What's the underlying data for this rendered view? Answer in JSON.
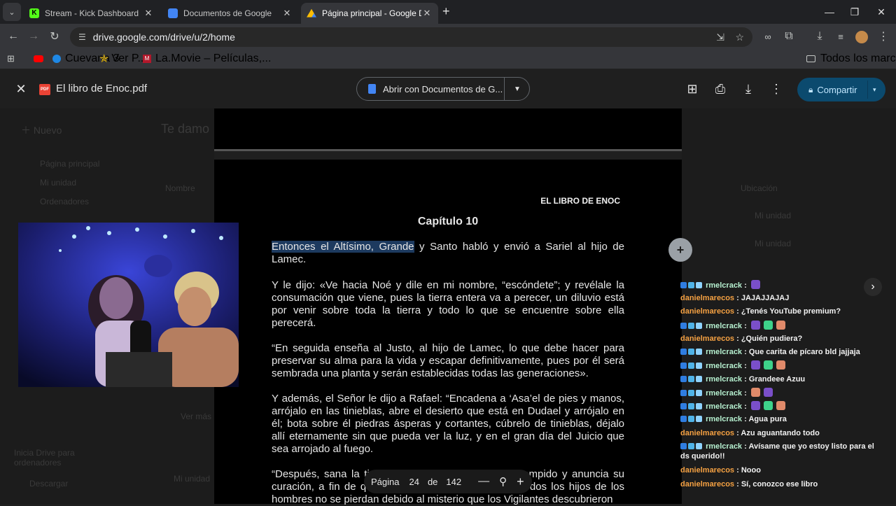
{
  "browser": {
    "tabs": [
      {
        "title": "Stream - Kick Dashboard",
        "favicon_color": "#53fc18"
      },
      {
        "title": "Documentos de Google",
        "favicon_color": "#4285f4"
      },
      {
        "title": "Página principal - Google Drive",
        "favicon_color": "#fbbc04"
      }
    ],
    "new_tab": "+",
    "url": "drive.google.com/drive/u/2/home",
    "bookmarks": [
      {
        "label": "",
        "icon": "youtube-icon"
      },
      {
        "label": "Cuevana 3",
        "icon": "cuevana-icon"
      },
      {
        "label": "Ver P...",
        "icon": "star-icon"
      },
      {
        "label": "La.Movie – Películas,...",
        "icon": "lamovie-icon"
      }
    ],
    "all_bookmarks": "Todos los marcadores"
  },
  "viewer": {
    "file_name": "El libro de Enoc.pdf",
    "open_with": "Abrir con Documentos de G...",
    "share": "Compartir"
  },
  "background_drive": {
    "new_button": "Nuevo",
    "greeting": "Te damo",
    "nav": [
      "Página principal",
      "Mi unidad",
      "Ordenadores"
    ],
    "col_name": "Nombre",
    "col_location": "Ubicación",
    "locations": [
      "Mi unidad",
      "Mi unidad"
    ],
    "storage_text": "Inicia Drive para ordenadores",
    "download": "Descargar",
    "my_drive_bottom": "Mi unidad",
    "ver_mas": "Ver más"
  },
  "pdf": {
    "header": "EL LIBRO DE ENOC",
    "chapter": "Capítulo 10",
    "p1_highlight": "Entonces el Altísimo, Grande",
    "p1_rest": " y Santo habló y envió a Sariel al hijo de Lamec.",
    "p2": "Y le dijo: «Ve hacia Noé y dile en mi nombre, “escóndete”; y revélale la consumación que viene, pues la tierra entera va a perecer, un diluvio está por venir sobre toda la tierra y todo lo que se encuentre sobre ella perecerá.",
    "p3": "“En seguida enseña al Justo, al hijo de Lamec, lo que debe hacer para preservar su alma para la vida y escapar definitivamente, pues por él será sembrada una planta y serán establecidas todas las generaciones».",
    "p4": "Y además, el Señor le dijo a Rafael: “Encadena a ‘Asa’el de pies y manos, arrójalo en las tinieblas, abre el desierto que está en Dudael y arrójalo en él; bota sobre él piedras ásperas y cortantes, cúbrelo de tinieblas, déjalo allí eternamente sin que pueda ver la luz, y en el gran día del Juicio que sea arrojado al fuego.",
    "p5": "“Después, sana la tierra que los Vigilantes han corrompido y anuncia su curación, a fin de que se sanen de la plaga y que todos los hijos de los hombres no se pierdan debido al misterio que los Vigilantes descubrieron"
  },
  "page_nav": {
    "label": "Página",
    "current": "24",
    "of": "de",
    "total": "142"
  },
  "chat": {
    "messages": [
      {
        "user": "rmelcrack",
        "text": "",
        "emotes": 1,
        "badges": true,
        "color": "nm1"
      },
      {
        "user": "danielmarecos",
        "text": " JAJAJJAJAJ",
        "emotes": 0,
        "badges": false,
        "color": "nm2"
      },
      {
        "user": "danielmarecos",
        "text": " ¿Tenés YouTube premium?",
        "emotes": 0,
        "badges": false,
        "color": "nm2"
      },
      {
        "user": "rmelcrack",
        "text": "",
        "emotes": 3,
        "badges": true,
        "color": "nm1"
      },
      {
        "user": "danielmarecos",
        "text": " ¿Quién pudiera?",
        "emotes": 0,
        "badges": false,
        "color": "nm2"
      },
      {
        "user": "rmelcrack",
        "text": " Que carita de pícaro bld jajjaja",
        "emotes": 0,
        "badges": true,
        "color": "nm1"
      },
      {
        "user": "rmelcrack",
        "text": "",
        "emotes": 3,
        "badges": true,
        "color": "nm1"
      },
      {
        "user": "rmelcrack",
        "text": " Grandeee Azuu",
        "emotes": 0,
        "badges": true,
        "color": "nm1"
      },
      {
        "user": "rmelcrack",
        "text": "",
        "emotes": 2,
        "badges": true,
        "color": "nm1"
      },
      {
        "user": "rmelcrack",
        "text": "",
        "emotes": 3,
        "badges": true,
        "color": "nm1"
      },
      {
        "user": "rmelcrack",
        "text": " Agua pura",
        "emotes": 0,
        "badges": true,
        "color": "nm1"
      },
      {
        "user": "danielmarecos",
        "text": " Azu aguantando todo",
        "emotes": 0,
        "badges": false,
        "color": "nm2"
      },
      {
        "user": "rmelcrack",
        "text": " Avísame que yo estoy listo para el ds querido!!",
        "emotes": 0,
        "badges": true,
        "color": "nm1"
      },
      {
        "user": "danielmarecos",
        "text": " Nooo",
        "emotes": 0,
        "badges": false,
        "color": "nm2"
      },
      {
        "user": "danielmarecos",
        "text": " Sí, conozco ese libro",
        "emotes": 0,
        "badges": false,
        "color": "nm2"
      }
    ]
  }
}
